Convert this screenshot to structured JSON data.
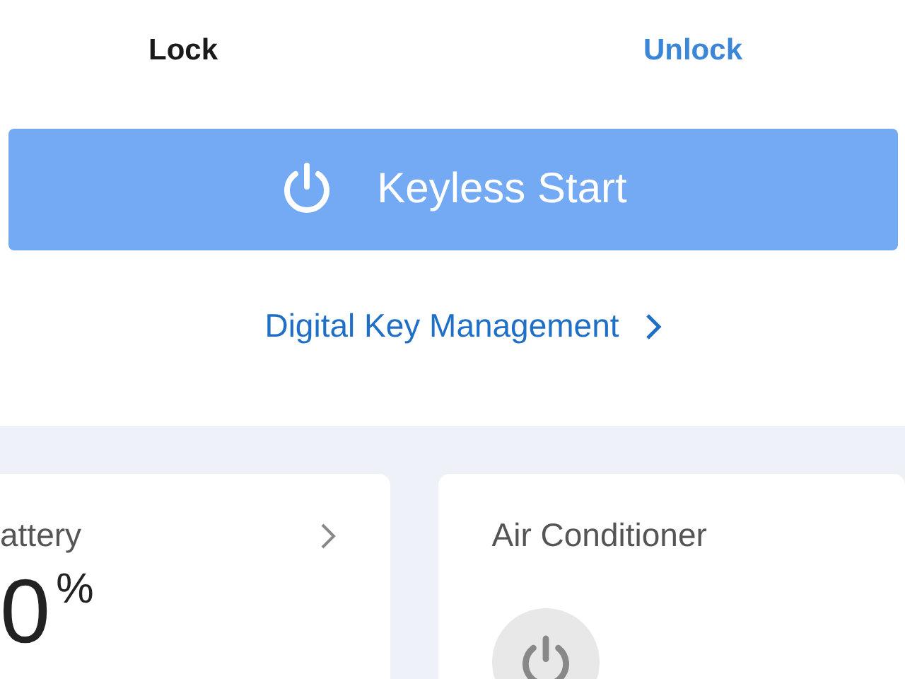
{
  "lock_actions": [
    {
      "label": "Lock",
      "selected": false
    },
    {
      "label": "Unlock",
      "selected": true
    }
  ],
  "keyless_start": {
    "label": "Keyless Start"
  },
  "digital_key_link": {
    "label": "Digital Key Management"
  },
  "cards": [
    {
      "kind": "battery",
      "title": "attery",
      "value": "0",
      "unit": "%"
    },
    {
      "kind": "climate",
      "title": "Air Conditioner",
      "on": false
    }
  ]
}
